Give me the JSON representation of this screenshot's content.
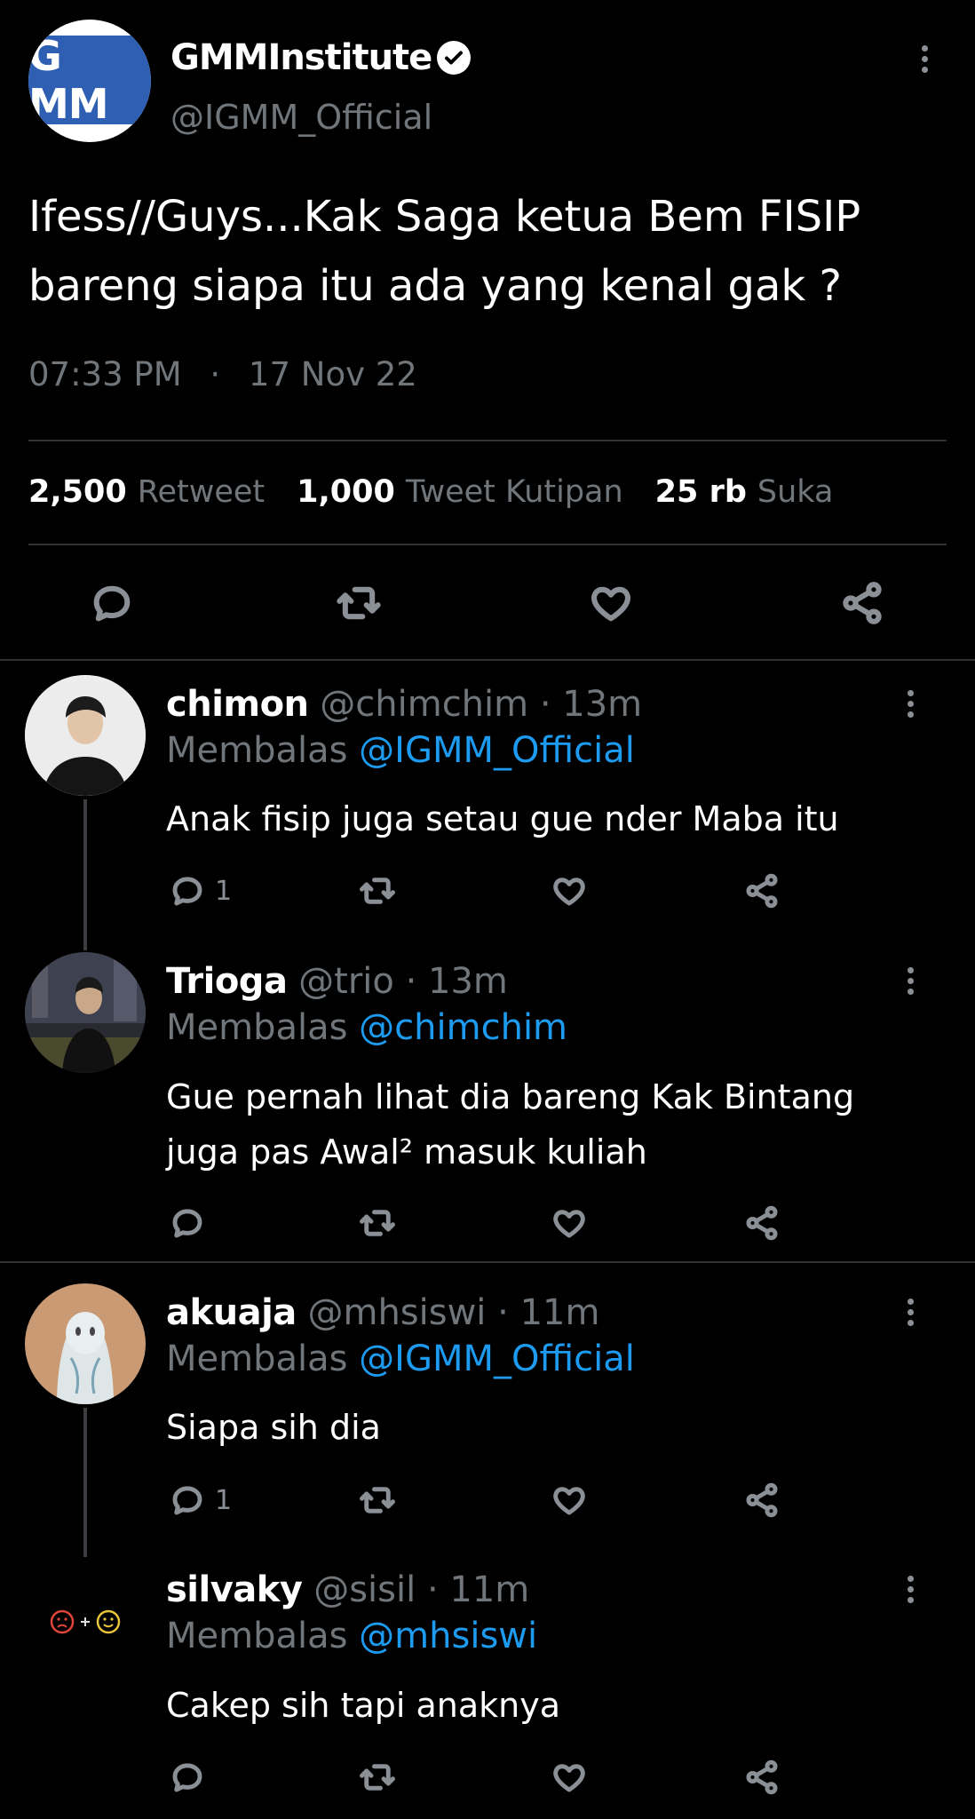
{
  "main_tweet": {
    "logo_text": "G MM",
    "author_name": "GMMInstitute",
    "author_handle": "@IGMM_Official",
    "text": "Ifess//Guys...Kak Saga ketua Bem FISIP bareng siapa itu ada yang kenal gak ?",
    "time": "07:33 PM",
    "separator": "·",
    "date": "17 Nov 22",
    "stats": {
      "retweets_count": "2,500",
      "retweets_label": "Retweet",
      "quotes_count": "1,000",
      "quotes_label": "Tweet Kutipan",
      "likes_count": "25 rb",
      "likes_label": "Suka"
    }
  },
  "replying_prefix": "Membalas",
  "replies": [
    {
      "name": "chimon",
      "handle": "@chimchim",
      "dot": "·",
      "time": "13m",
      "replying_to": "@IGMM_Official",
      "text": "Anak fisip juga setau gue nder Maba itu",
      "reply_count": "1"
    },
    {
      "name": "Trioga",
      "handle": "@trio",
      "dot": "·",
      "time": "13m",
      "replying_to": "@chimchim",
      "text": "Gue pernah lihat dia bareng Kak Bintang juga pas Awal² masuk kuliah",
      "reply_count": ""
    },
    {
      "name": "akuaja",
      "handle": "@mhsiswi",
      "dot": "·",
      "time": "11m",
      "replying_to": "@IGMM_Official",
      "text": "Siapa sih dia",
      "reply_count": "1"
    },
    {
      "name": "silvaky",
      "handle": "@sisil",
      "dot": "·",
      "time": "11m",
      "replying_to": "@mhsiswi",
      "text": "Cakep sih tapi anaknya",
      "reply_count": ""
    }
  ],
  "colors": {
    "background": "#000000",
    "muted": "#71767b",
    "link": "#1d9bf0",
    "divider": "#2f3336"
  }
}
